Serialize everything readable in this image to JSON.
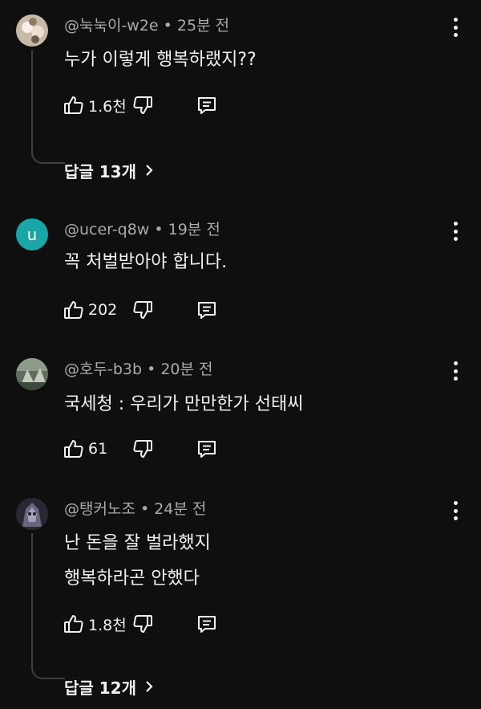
{
  "comments": [
    {
      "handle": "@눅눅이-w2e",
      "time": "• 25분 전",
      "text_lines": [
        "누가 이렇게 행복하랬지??"
      ],
      "likes": "1.6천",
      "avatar": {
        "kind": "image",
        "color": "#b8a79a"
      },
      "replies": "답글 13개"
    },
    {
      "handle": "@ucer-q8w",
      "time": "• 19분 전",
      "text_lines": [
        "꼭 처벌받아야 합니다."
      ],
      "likes": "202",
      "avatar": {
        "kind": "letter",
        "letter": "u",
        "color": "#1aa5a9"
      }
    },
    {
      "handle": "@호두-b3b",
      "time": "• 20분 전",
      "text_lines": [
        "국세청 : 우리가 만만한가 선태씨"
      ],
      "likes": "61",
      "avatar": {
        "kind": "image",
        "color": "#7a8a78"
      }
    },
    {
      "handle": "@탱커노조",
      "time": "• 24분 전",
      "text_lines": [
        "난 돈을 잘 벌라했지",
        "행복하라곤 안했다"
      ],
      "likes": "1.8천",
      "avatar": {
        "kind": "image",
        "color": "#4a4658"
      },
      "replies": "답글 12개"
    }
  ],
  "icons": {
    "like": "thumbs-up-icon",
    "dislike": "thumbs-down-icon",
    "reply": "reply-icon",
    "more": "more-vert-icon",
    "chevron": "chevron-right-icon"
  }
}
